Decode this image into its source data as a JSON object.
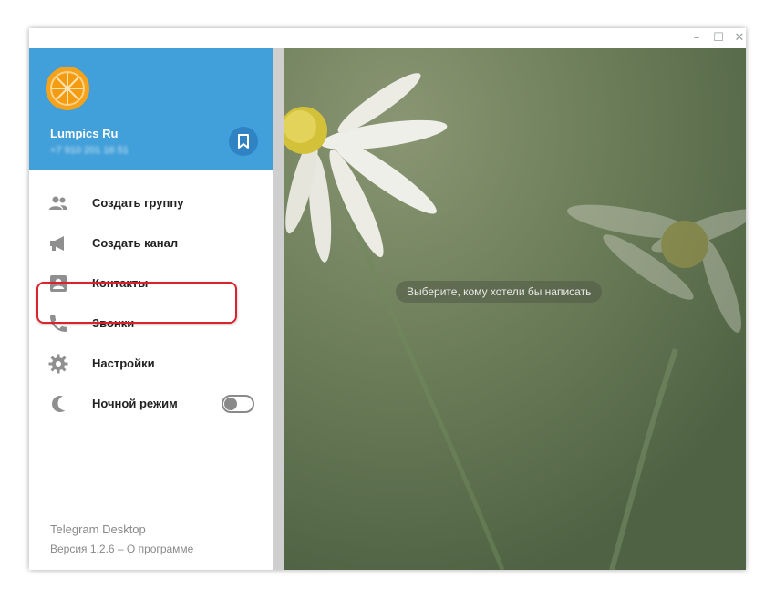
{
  "window": {
    "controls": {
      "minimize": "–",
      "maximize": "☐",
      "close": "✕"
    }
  },
  "profile": {
    "name": "Lumpics Ru",
    "phone": "+7 910 201 16 51"
  },
  "menu": {
    "items": [
      {
        "label": "Создать группу",
        "icon": "group-icon"
      },
      {
        "label": "Создать канал",
        "icon": "megaphone-icon"
      },
      {
        "label": "Контакты",
        "icon": "contacts-icon"
      },
      {
        "label": "Звонки",
        "icon": "phone-icon"
      },
      {
        "label": "Настройки",
        "icon": "gear-icon"
      },
      {
        "label": "Ночной режим",
        "icon": "moon-icon"
      }
    ],
    "night_mode_on": false
  },
  "footer": {
    "app_name": "Telegram Desktop",
    "version": "Версия 1.2.6",
    "separator": " – ",
    "about": "О программе"
  },
  "chat": {
    "empty_hint": "Выберите, кому хотели бы написать"
  },
  "colors": {
    "accent": "#419fd9",
    "highlight": "#d9232d"
  }
}
